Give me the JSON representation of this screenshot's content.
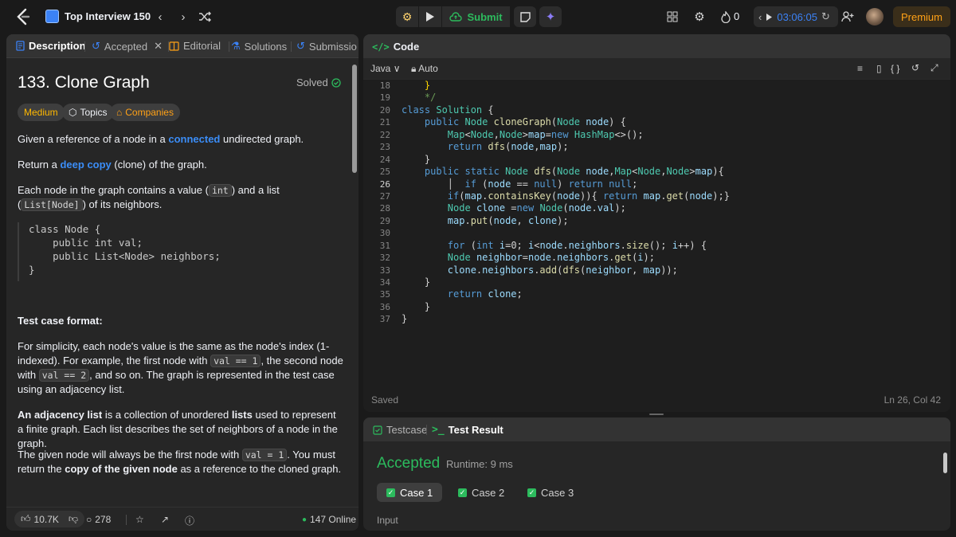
{
  "topbar": {
    "list_title": "Top Interview 150",
    "submit_label": "Submit",
    "streak_count": "0",
    "timer": "03:06:05",
    "premium_label": "Premium"
  },
  "left": {
    "tabs": [
      {
        "label": "Description"
      },
      {
        "label": "Accepted"
      },
      {
        "label": "Editorial"
      },
      {
        "label": "Solutions"
      },
      {
        "label": "Submissio"
      }
    ],
    "title": "133. Clone Graph",
    "solved_label": "Solved",
    "chips": {
      "difficulty": "Medium",
      "topics": "Topics",
      "companies": "Companies"
    },
    "p1_a": "Given a reference of a node in a ",
    "p1_link": "connected",
    "p1_b": " undirected graph.",
    "p2_a": "Return a ",
    "p2_link": "deep copy",
    "p2_b": " (clone) of the graph.",
    "p3_a": "Each node in the graph contains a value (",
    "p3_code1": "int",
    "p3_b": ") and a list (",
    "p3_code2": "List[Node]",
    "p3_c": ") of its neighbors.",
    "code_block": [
      "class Node {",
      "    public int val;",
      "    public List<Node> neighbors;",
      "}"
    ],
    "test_case_heading": "Test case format:",
    "p4_a": "For simplicity, each node's value is the same as the node's index (1-indexed). For example, the first node with ",
    "p4_code1": "val == 1",
    "p4_b": ", the second node with ",
    "p4_code2": "val == 2",
    "p4_c": ", and so on. The graph is represented in the test case using an adjacency list.",
    "p5_bold": "An adjacency list",
    "p5_a": " is a collection of unordered ",
    "p5_bold2": "lists",
    "p5_b": " used to represent a finite graph. Each list describes the set of neighbors of a node in the graph.",
    "p6_a": "The given node will always be the first node with ",
    "p6_code": "val = 1",
    "p6_b": ". You must return the ",
    "p6_bold": "copy of the given node",
    "p6_c": " as a reference to the cloned graph.",
    "footer": {
      "likes": "10.7K",
      "comments": "278",
      "online": "147 Online"
    }
  },
  "code": {
    "header_label": "Code",
    "language": "Java",
    "mode": "Auto",
    "saved": "Saved",
    "cursor": "Ln 26, Col 42",
    "line_numbers": [
      "18",
      "19",
      "20",
      "21",
      "22",
      "23",
      "24",
      "25",
      "26",
      "27",
      "28",
      "29",
      "30",
      "31",
      "32",
      "33",
      "34",
      "35",
      "36",
      "37"
    ]
  },
  "test": {
    "tab_testcase": "Testcase",
    "tab_result": "Test Result",
    "status": "Accepted",
    "runtime": "Runtime: 9 ms",
    "cases": [
      "Case 1",
      "Case 2",
      "Case 3"
    ],
    "input_label": "Input"
  },
  "colors": {
    "accent_green": "#2cbb5d",
    "accent_orange": "#ffa116",
    "accent_blue": "#3b82f6"
  }
}
